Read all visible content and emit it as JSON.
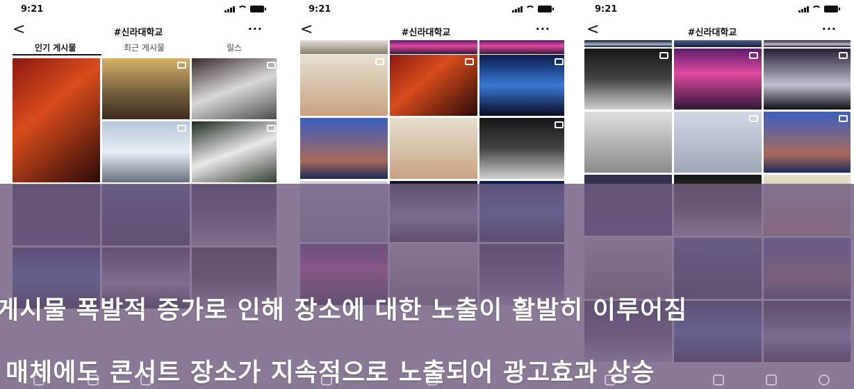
{
  "screens": [
    {
      "time": "9:21",
      "title": "#신라대학교",
      "tabs": [
        "인기 게시물",
        "최근 게시물",
        "릴스"
      ]
    },
    {
      "time": "9:21",
      "title": "#신라대학교"
    },
    {
      "time": "9:21",
      "title": "#신라대학교"
    }
  ],
  "overlay": {
    "line1": "게시물 폭발적 증가로 인해 장소에 대한 노출이 활발히 이루어짐",
    "line2": "매체에도 콘서트 장소가 지속적으로 노출되어 광고효과 상승"
  },
  "icons": {
    "back": "chevron-left-icon",
    "more": "more-icon",
    "post_type": "reels-icon"
  }
}
